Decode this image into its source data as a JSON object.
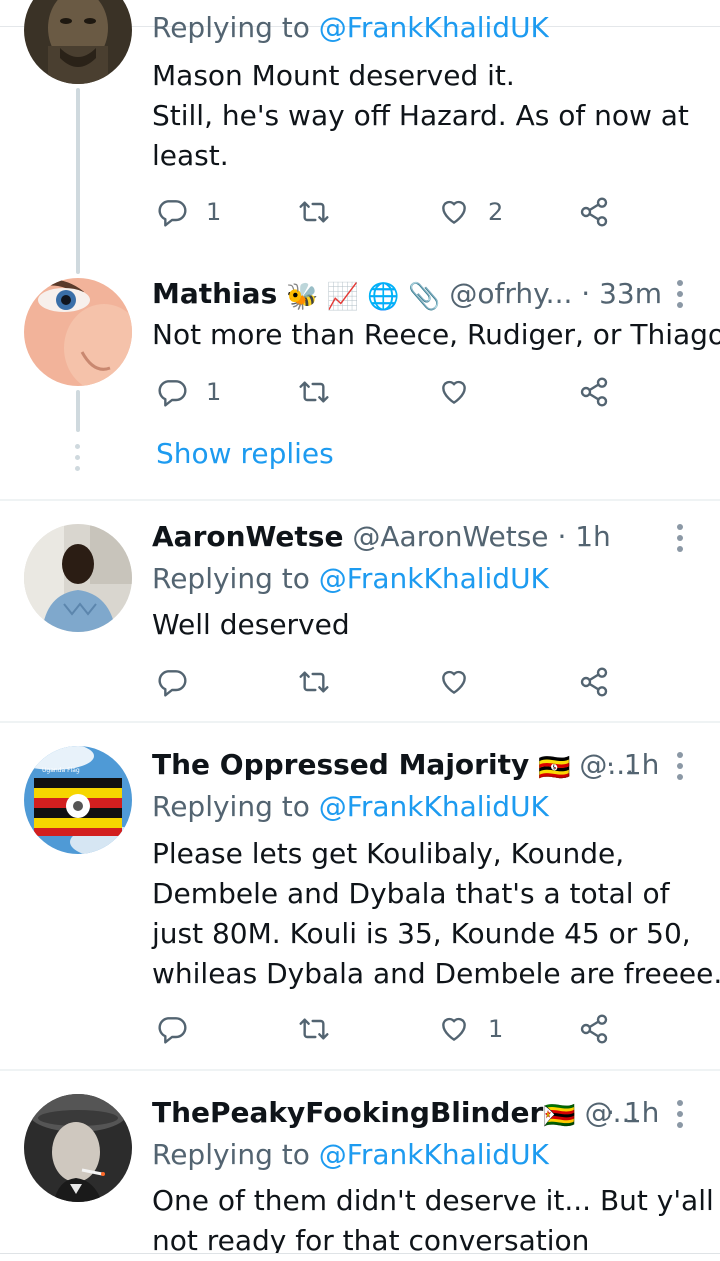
{
  "tweets": [
    {
      "replying_label": "Replying to",
      "replying_handle": "@FrankKhalidUK",
      "body": [
        "Mason Mount deserved it.",
        "Still, he's way off Hazard. As of now at",
        "least."
      ],
      "reply_count": "1",
      "like_count": "2"
    },
    {
      "name": "Mathias",
      "name_emojis": "🐝 📈 🌐 📎",
      "handle": "@ofrhy...",
      "time": "· 33m",
      "body": [
        "Not more than Reece, Rudiger, or Thiago"
      ],
      "reply_count": "1",
      "show_replies": "Show replies"
    },
    {
      "name": "AaronWetse",
      "handle": "@AaronWetse",
      "time": "· 1h",
      "replying_label": "Replying to",
      "replying_handle": "@FrankKhalidUK",
      "body": [
        "Well deserved"
      ]
    },
    {
      "name": "The Oppressed Majority",
      "name_emojis": "🇺🇬",
      "handle": "@...",
      "time": "· 1h",
      "replying_label": "Replying to",
      "replying_handle": "@FrankKhalidUK",
      "body": [
        "Please lets get Koulibaly, Kounde,",
        "Dembele and Dybala that's a total of",
        "just 80M. Kouli is 35, Kounde 45 or 50,",
        "whileas Dybala and Dembele are freeee."
      ],
      "like_count": "1",
      "avatar_banner": "Uganda Flag"
    },
    {
      "name": "ThePeakyFookingBlinder",
      "name_emojis": "🇿🇼",
      "handle": "@...",
      "time": "· 1h",
      "replying_label": "Replying to",
      "replying_handle": "@FrankKhalidUK",
      "body": [
        "One of them didn't deserve it... But y'all",
        "not ready for that conversation"
      ]
    }
  ],
  "colors": {
    "link": "#1d9bf0",
    "secondary": "#536471",
    "thread_line": "#cfd9de",
    "divider": "#eff3f4"
  },
  "icons": [
    "reply-icon",
    "retweet-icon",
    "like-icon",
    "share-icon",
    "more-icon"
  ]
}
